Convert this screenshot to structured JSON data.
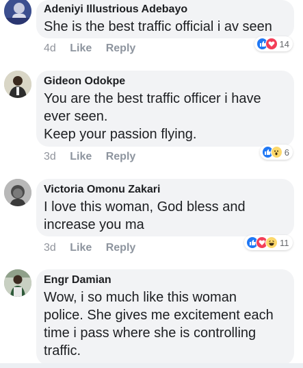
{
  "comments": [
    {
      "author": "Adeniyi Illustrious Adebayo",
      "text": "She is the best traffic official i av seen",
      "time": "4d",
      "like_label": "Like",
      "reply_label": "Reply",
      "reactions": [
        "like-icon",
        "love-icon"
      ],
      "reaction_count": "14",
      "avatar_color": "#3c4f8f"
    },
    {
      "author": "Gideon Odokpe",
      "text": "You are the best traffic officer i have\never seen.\nKeep your passion flying.",
      "time": "3d",
      "like_label": "Like",
      "reply_label": "Reply",
      "reactions": [
        "like-icon",
        "wow-icon"
      ],
      "reaction_count": "6",
      "avatar_color": "#bdb9a4"
    },
    {
      "author": "Victoria Omonu Zakari",
      "text": "I love this woman, God bless and\nincrease you ma",
      "time": "3d",
      "like_label": "Like",
      "reply_label": "Reply",
      "reactions": [
        "like-icon",
        "love-icon",
        "haha-icon"
      ],
      "reaction_count": "11",
      "avatar_color": "#8a8a8a"
    },
    {
      "author": "Engr Damian",
      "text": "Wow, i so much like this woman\npolice. She gives me excitement each\ntime i pass where she is controlling\ntraffic.",
      "avatar_color": "#7e8a78"
    }
  ],
  "colors": {
    "bubble": "#f2f3f5",
    "like_blue": "#2078f4",
    "love_red": "#f33e58",
    "muted": "#90949c"
  }
}
